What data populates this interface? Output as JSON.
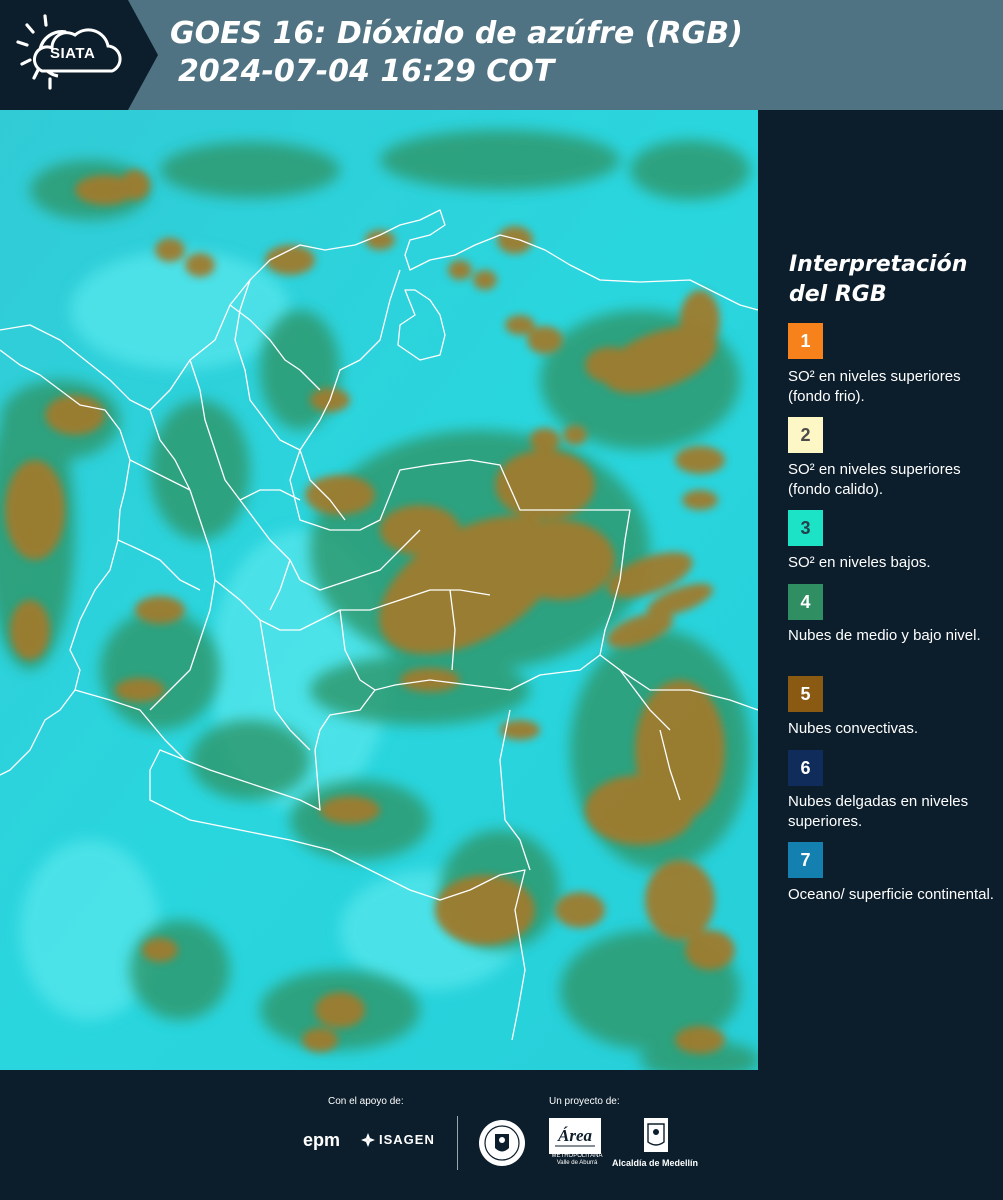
{
  "header": {
    "logo_text": "SIATA",
    "title_line1": "GOES 16: Dióxido de azúfre (RGB)",
    "title_line2": "2024-07-04 16:29 COT"
  },
  "legend": {
    "title": "Interpretación del RGB",
    "items": [
      {
        "number": "1",
        "color": "#f7821b",
        "text_color": "#ffffff",
        "label": "SO² en niveles superiores (fondo frio)."
      },
      {
        "number": "2",
        "color": "#fdf7c6",
        "text_color": "#4b4b4b",
        "label": "SO² en niveles superiores (fondo calido)."
      },
      {
        "number": "3",
        "color": "#1de3c6",
        "text_color": "#23404b",
        "label": "SO² en niveles bajos."
      },
      {
        "number": "4",
        "color": "#2f8f63",
        "text_color": "#ffffff",
        "label": "Nubes de medio y bajo nivel."
      },
      {
        "number": "5",
        "color": "#8a5a12",
        "text_color": "#ffffff",
        "label": "Nubes convectivas."
      },
      {
        "number": "6",
        "color": "#0f2c5a",
        "text_color": "#ffffff",
        "label": "Nubes delgadas en niveles superiores."
      },
      {
        "number": "7",
        "color": "#1380b0",
        "text_color": "#ffffff",
        "label": "Oceano/ superficie continental."
      }
    ]
  },
  "footer": {
    "support_label": "Con el apoyo de:",
    "project_label": "Un proyecto de:",
    "sponsors": [
      "epm",
      "ISAGEN"
    ],
    "partners": [
      "Área Metropolitana Valle de Aburrá",
      "Alcaldía de Medellín"
    ],
    "epm_text": "epm",
    "isagen_text": "ISAGEN",
    "area_text": "Área",
    "area_sub": "METROPOLITANA Valle de Aburrá",
    "alcaldia_text": "Alcaldía de Medellín"
  },
  "colors": {
    "header_bg": "#4f7382",
    "panel_bg": "#0c1e2c",
    "map_cyan": "#29d3dc",
    "map_green": "#2f9a70",
    "map_brown": "#9a7a30",
    "borders": "#ffffff"
  }
}
